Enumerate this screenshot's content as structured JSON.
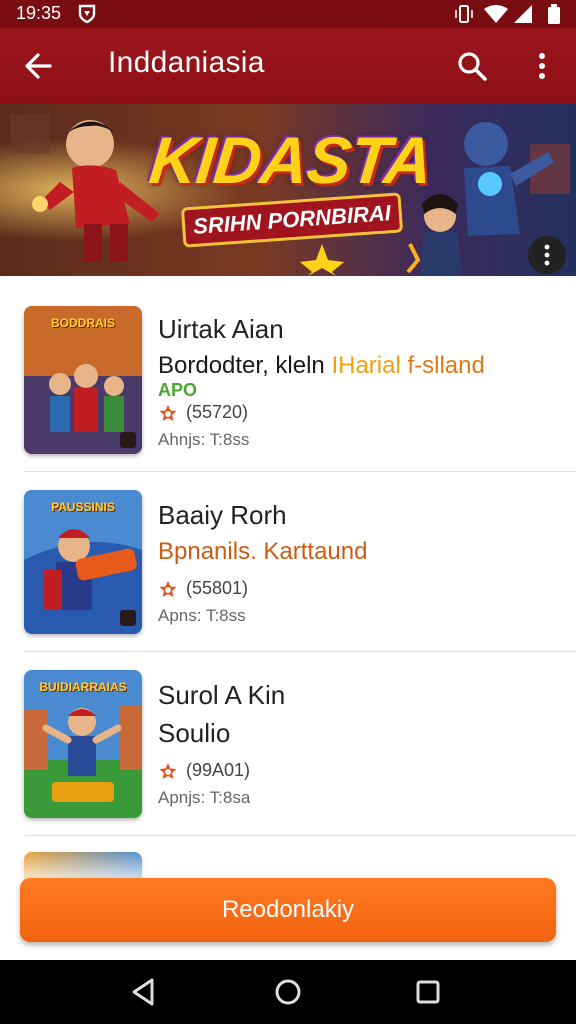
{
  "status": {
    "time": "19:35",
    "icons": [
      "shield-icon",
      "vibrate-icon",
      "wifi-icon",
      "signal-icon",
      "battery-icon"
    ]
  },
  "app_bar": {
    "title": "Inddaniasia",
    "back_icon": "arrow-back-icon",
    "search_icon": "search-icon",
    "menu_icon": "more-vert-icon"
  },
  "banner": {
    "title": "KIDASTA",
    "subtitle": "SRIHN PORNBIRAI"
  },
  "items": [
    {
      "thumb_label": "BODDRAIS",
      "title": "Uirtak Aian",
      "subtitle_main": "Bordodter, kleln ",
      "subtitle_accent": "IHarial ",
      "subtitle_tail": "f-slland",
      "tag": "APO",
      "rating": "(55720)",
      "meta": "Ahnjs: T:8ss"
    },
    {
      "thumb_label": "PAUSSINIS",
      "title": "Baaiy Rorh",
      "subtitle_main": "Bpnanils. Karttaund",
      "subtitle_accent": "",
      "subtitle_tail": "",
      "tag": "",
      "rating": "(55801)",
      "meta": "Apns: T:8ss"
    },
    {
      "thumb_label": "BUIDIARRAIAS",
      "title": "Surol A Kin",
      "subtitle_main": "Soulio",
      "subtitle_accent": "",
      "subtitle_tail": "",
      "tag": "",
      "rating": "(99A01)",
      "meta": "Apnjs: T:8sa"
    }
  ],
  "cta": {
    "label": "Reodonlakiy"
  },
  "colors": {
    "primary": "#8c1016",
    "status_bar": "#7a0d12",
    "accent_orange": "#f26310",
    "rating_star": "#e8501a"
  }
}
